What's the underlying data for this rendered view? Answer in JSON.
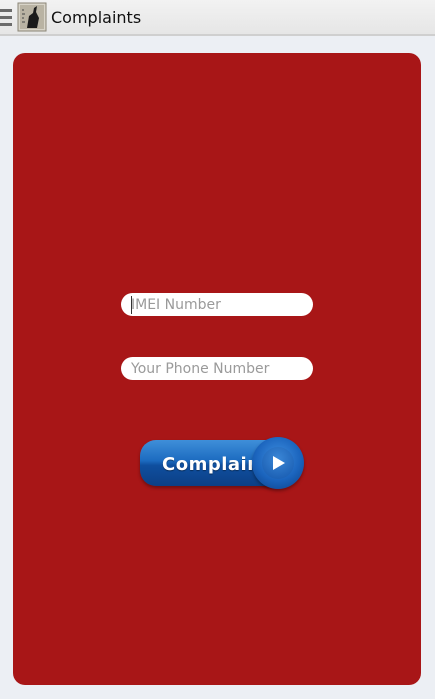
{
  "actionbar": {
    "title": "Complaints",
    "menu_icon": "hamburger-menu-icon",
    "app_icon": "app-logo-icon"
  },
  "form": {
    "imei_placeholder": "IMEI Number",
    "imei_value": "",
    "phone_placeholder": "Your Phone Number",
    "phone_value": "",
    "submit_label": "Complain",
    "submit_icon": "play-arrow-icon"
  },
  "colors": {
    "card_background": "#a81617",
    "button_blue": "#1c6bc0",
    "actionbar_background": "#eeeeee"
  }
}
